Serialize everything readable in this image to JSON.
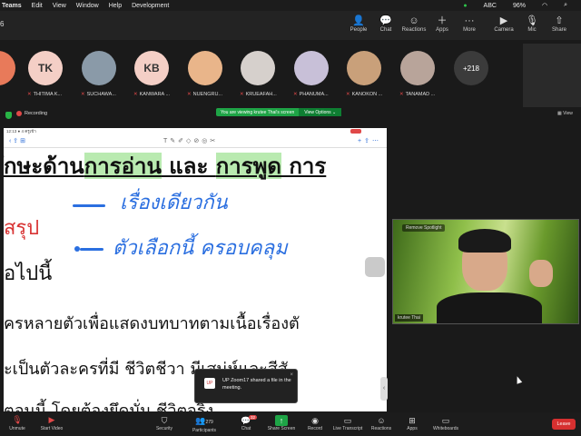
{
  "menubar": {
    "app": "Teams",
    "items": [
      "Edit",
      "View",
      "Window",
      "Help",
      "Development"
    ],
    "status": {
      "battery": "96%",
      "input": "ABC"
    }
  },
  "topbar": {
    "meeting_id": "6",
    "buttons": [
      {
        "label": "People",
        "icon": "people-icon"
      },
      {
        "label": "Chat",
        "icon": "chat-icon"
      },
      {
        "label": "Reactions",
        "icon": "reactions-icon"
      },
      {
        "label": "Apps",
        "icon": "apps-icon"
      },
      {
        "label": "More",
        "icon": "more-icon"
      },
      {
        "label": "Camera",
        "icon": "camera-icon"
      },
      {
        "label": "Mic",
        "icon": "mic-icon"
      },
      {
        "label": "Share",
        "icon": "share-icon"
      }
    ]
  },
  "participants": [
    {
      "initials": "",
      "name": "",
      "color": "#e87a5a"
    },
    {
      "initials": "TK",
      "name": "THITIMA K...",
      "color": "#f4cfc6"
    },
    {
      "initials": "",
      "name": "SUCHAWA...",
      "color": "#8a9aa8"
    },
    {
      "initials": "KB",
      "name": "KANWARA ...",
      "color": "#f4cfc6"
    },
    {
      "initials": "",
      "name": "NUENGRU...",
      "color": "#e9b58a"
    },
    {
      "initials": "",
      "name": "KRUEAFAH...",
      "color": "#d6d0cc"
    },
    {
      "initials": "",
      "name": "PHANUMA...",
      "color": "#c8c0d8"
    },
    {
      "initials": "",
      "name": "KANOKON ...",
      "color": "#c9a07a"
    },
    {
      "initials": "",
      "name": "TANAMAD ...",
      "color": "#b8a49a"
    }
  ],
  "more_participants": "+218",
  "self_view_label": "View",
  "recording_label": "Recording",
  "viewing_banner": {
    "text": "You are viewing krutee Thai's screen",
    "options": "View Options ⌄"
  },
  "shared": {
    "status": "12:13  ● 4 ครูเข้า",
    "line1_parts": [
      "ักษะด้าน",
      "การอ่าน",
      " และ ",
      "การพูด",
      " การ"
    ],
    "hw1": "เรื่องเดียวกัน",
    "hw2": "ตัวเลือกนี้ ครอบคลุม",
    "red_word": "สรุป",
    "line_after": "อไปนี้",
    "line_b1": "ครหลายตัวเพื่อแสดงบทบาทตามเนื้อเรื่องตั",
    "line_b2": "ะเป็นตัวละครที่มี ชีวิตชีวา มีเสน่ห์และสีสั",
    "line_b3": "ตอนนี้ โดยต้องยึดมั่น                  ชีวิตจริง"
  },
  "notice": {
    "text": "UP Zoom17 shared a file in the meeting."
  },
  "speaker": {
    "label": "Remove Spotlight",
    "name": "krutee Thai"
  },
  "bottombar": {
    "items": [
      {
        "label": "Unmute",
        "icon": "mic-off-icon"
      },
      {
        "label": "Start Video",
        "icon": "video-off-icon"
      },
      {
        "label": "Security",
        "icon": "shield-icon"
      },
      {
        "label": "Participants",
        "icon": "participants-icon",
        "count": "279"
      },
      {
        "label": "Chat",
        "icon": "chat-icon",
        "badge": "32"
      },
      {
        "label": "Share Screen",
        "icon": "share-screen-icon"
      },
      {
        "label": "Record",
        "icon": "record-icon"
      },
      {
        "label": "Live Transcript",
        "icon": "cc-icon"
      },
      {
        "label": "Reactions",
        "icon": "reactions-icon"
      },
      {
        "label": "Apps",
        "icon": "apps-icon"
      },
      {
        "label": "Whiteboards",
        "icon": "whiteboard-icon"
      }
    ],
    "leave": "Leave"
  }
}
